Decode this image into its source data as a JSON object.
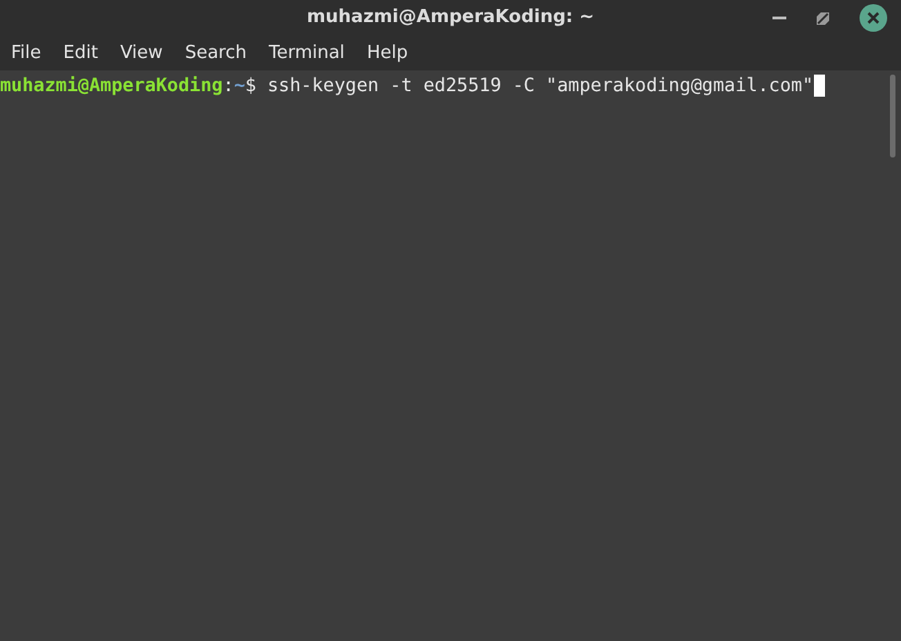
{
  "window": {
    "title": "muhazmi@AmperaKoding: ~"
  },
  "menu": [
    "File",
    "Edit",
    "View",
    "Search",
    "Terminal",
    "Help"
  ],
  "terminal": {
    "lines": [
      {
        "user_host": "muhazmi@AmperaKoding",
        "separator": ":",
        "path": "~",
        "symbol": "$",
        "command": "ssh-keygen -t ed25519 -C \"amperakoding@gmail.com\""
      }
    ]
  }
}
